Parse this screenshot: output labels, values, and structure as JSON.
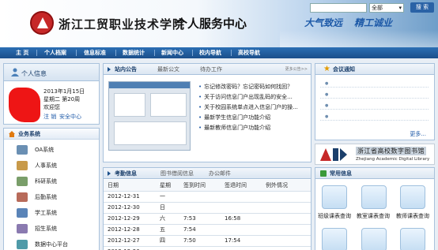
{
  "header": {
    "school_name": "浙江工贸职业技术学院",
    "center_name": "个人服务中心",
    "slogan_1": "大气致远",
    "slogan_2": "精工诚业",
    "search_scope": "全部",
    "search_button": "搜 索"
  },
  "nav": {
    "items": [
      "主 页",
      "个人档案",
      "信息标准",
      "数据统计",
      "新闻中心",
      "校内导航",
      "高校导航"
    ]
  },
  "personal": {
    "title": "个人信息",
    "date": "2013年1月15日",
    "weekday_week": "星期二   第20周",
    "welcome": "欢迎您",
    "logout": "注 销",
    "security": "安全中心"
  },
  "business": {
    "title": "业务系统",
    "systems": [
      "OA系统",
      "人事系统",
      "科研系统",
      "后勤系统",
      "学工系统",
      "招生系统",
      "数据中心平台"
    ]
  },
  "news": {
    "tabs": [
      "站内公告",
      "最新公文",
      "待办工作"
    ],
    "more": "更多公告>>",
    "items": [
      "忘记修改密码？忘记密码如何找回？",
      "关于访问信息门户出现乱码的安全...",
      "关于校园系统单点进入信息门户的操...",
      "最新学生信息门户功能介绍",
      "最新教师信息门户功能介绍"
    ]
  },
  "notice": {
    "title": "会议通知",
    "more": "更多..."
  },
  "library": {
    "name_cn": "浙江省高校数字图书馆",
    "name_en": "Zhejiang Academic Digital Library"
  },
  "attendance": {
    "tabs": [
      "考勤信息",
      "图书借阅信息",
      "办公邮件"
    ],
    "headers": [
      "日期",
      "星期",
      "签到时间",
      "签退时间",
      "例外情况"
    ],
    "rows": [
      [
        "2012-12-31",
        "一",
        "",
        "",
        ""
      ],
      [
        "2012-12-30",
        "日",
        "",
        "",
        ""
      ],
      [
        "2012-12-29",
        "六",
        "7:53",
        "16:58",
        ""
      ],
      [
        "2012-12-28",
        "五",
        "7:54",
        "",
        ""
      ],
      [
        "2012-12-27",
        "四",
        "7:50",
        "17:54",
        ""
      ],
      [
        "2012-12-26",
        "",
        "",
        "",
        ""
      ]
    ]
  },
  "common": {
    "title": "常用信息",
    "tiles": [
      "班级课表查询",
      "教室课表查询",
      "教师课表查询"
    ]
  }
}
